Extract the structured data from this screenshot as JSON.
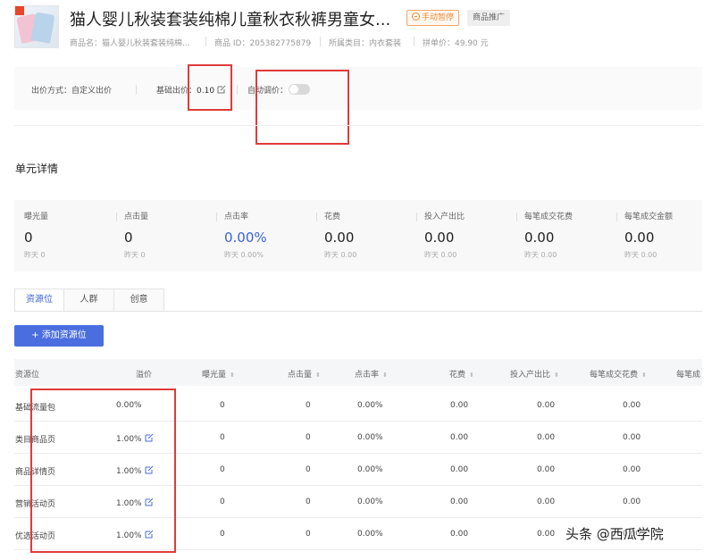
{
  "header": {
    "title": "猫人婴儿秋装套装纯棉儿童秋衣秋裤男童女...",
    "status_badge": "手动暂停",
    "type_badge": "商品推广",
    "meta": {
      "name": "商品名：猫人婴儿秋装套装纯棉...",
      "id": "商品 ID：205382775879",
      "category": "所属类目：内衣套装",
      "price": "拼单价：49.90 元"
    }
  },
  "bid": {
    "mode": "出价方式：自定义出价",
    "base_label": "基础出价：",
    "base_value": "0.10",
    "auto_label": "自动调价："
  },
  "section": {
    "title": "单元详情"
  },
  "metrics": [
    {
      "label": "曝光量",
      "value": "0",
      "sub": "昨天 0"
    },
    {
      "label": "点击量",
      "value": "0",
      "sub": "昨天 0"
    },
    {
      "label": "点击率",
      "value": "0.00%",
      "sub": "昨天 0.00%"
    },
    {
      "label": "花费",
      "value": "0.00",
      "sub": "昨天 0.00"
    },
    {
      "label": "投入产出比",
      "value": "0.00",
      "sub": "昨天 0.00"
    },
    {
      "label": "每笔成交花费",
      "value": "0.00",
      "sub": "昨天 0.00"
    },
    {
      "label": "每笔成交金额",
      "value": "0.00",
      "sub": "昨天 0.00"
    }
  ],
  "tabs": [
    "资源位",
    "人群",
    "创意"
  ],
  "add_button": "+ 添加资源位",
  "table": {
    "headers": [
      "资源位",
      "溢价",
      "曝光量",
      "点击量",
      "点击率",
      "花费",
      "投入产出比",
      "每笔成交花费",
      "每笔成"
    ],
    "rows": [
      [
        "基础流量包",
        "0.00%",
        "0",
        "0",
        "0.00%",
        "0.00",
        "0.00",
        "0.00"
      ],
      [
        "类目商品页",
        "1.00%",
        "0",
        "0",
        "0.00%",
        "0.00",
        "0.00",
        "0.00"
      ],
      [
        "商品详情页",
        "1.00%",
        "0",
        "0",
        "0.00%",
        "0.00",
        "0.00",
        "0.00"
      ],
      [
        "营销活动页",
        "1.00%",
        "0",
        "0",
        "0.00%",
        "0.00",
        "0.00",
        "0.00"
      ],
      [
        "优选活动页",
        "1.00%",
        "0",
        "0",
        "0.00%",
        "0.00",
        "0.00",
        "0.00"
      ]
    ]
  },
  "watermark": "头条 @西瓜学院",
  "colors": {
    "accent": "#4a6ee0",
    "annotation": "#e03a3a",
    "status": "#f08a35"
  }
}
